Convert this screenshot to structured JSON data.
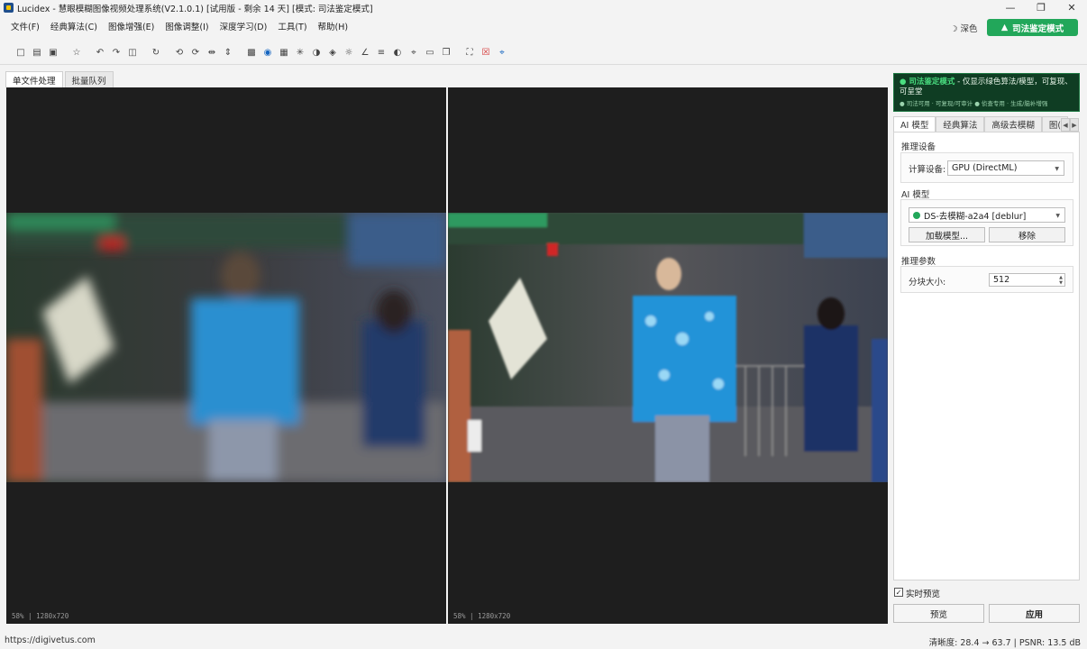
{
  "window": {
    "title": "Lucidex - 慧眼模糊图像视频处理系统(V2.1.0.1)  [试用版 - 剩余 14 天]  [模式: 司法鉴定模式]",
    "minimize_icon": "minimize-icon",
    "restore_icon": "restore-icon",
    "close_icon": "close-icon"
  },
  "menu": {
    "items": [
      "文件(F)",
      "经典算法(C)",
      "图像增强(E)",
      "图像调整(I)",
      "深度学习(D)",
      "工具(T)",
      "帮助(H)"
    ]
  },
  "header": {
    "theme_label": "☽ 深色",
    "forensic_button": "司法鉴定模式",
    "forensic_color": "#22a75a"
  },
  "toolbar": {
    "icons": [
      "open-file-icon",
      "open-folder-icon",
      "save-icon",
      "favorite-icon",
      "undo-icon",
      "redo-icon",
      "compare-icon",
      "reset-icon",
      "rotate-left-icon",
      "rotate-right-icon",
      "flip-horizontal-icon",
      "flip-vertical-icon",
      "histogram-icon",
      "mask-icon",
      "image-icon",
      "denoise-icon",
      "contrast-icon",
      "layers-icon",
      "brightness-icon",
      "curves-icon",
      "levels-icon",
      "invert-icon",
      "crop-icon",
      "rect-select-icon",
      "overlay-icon",
      "fullscreen-icon",
      "delete-crop-icon",
      "crop-active-icon"
    ]
  },
  "main_tabs": [
    "单文件处理",
    "批量队列"
  ],
  "viewports": {
    "left_info": "58%  |  1280x720",
    "right_info": "58%  |  1280x720"
  },
  "banner": {
    "highlight": "● 司法鉴定模式",
    "text": " - 仅显示绿色算法/模型，可复现、可呈堂",
    "sub": "● 司法可用 · 可复现/可审计   ● 侦查专用 · 生成/脑补增强"
  },
  "side_tabs": [
    "AI 模型",
    "经典算法",
    "高级去模糊",
    "图("
  ],
  "panel": {
    "device_section": "推理设备",
    "device_label": "计算设备:",
    "device_value": "GPU (DirectML)",
    "model_section": "AI 模型",
    "model_value": "DS-去模糊-a2a4 [deblur]",
    "load_model": "加载模型...",
    "remove": "移除",
    "params_section": "推理参数",
    "tile_label": "分块大小:",
    "tile_value": "512"
  },
  "footer": {
    "realtime_preview": "实时预览",
    "realtime_checked": true,
    "preview_button": "预览",
    "apply_button": "应用"
  },
  "status": {
    "url": "https://digivetus.com",
    "metrics": "清晰度: 28.4 → 63.7  |  PSNR: 13.5 dB"
  }
}
